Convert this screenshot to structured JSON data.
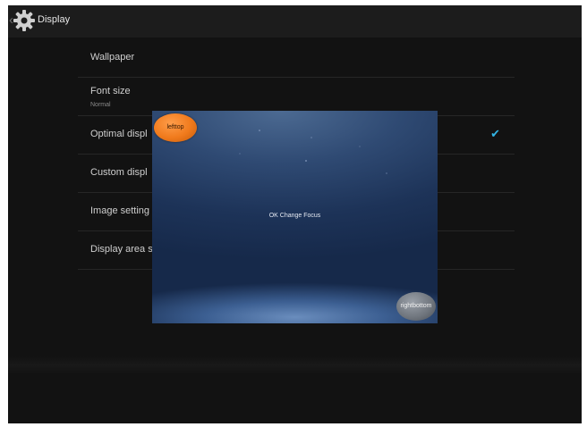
{
  "action_bar": {
    "title": "Display",
    "icon": "gear-icon"
  },
  "list": {
    "items": [
      {
        "label": "Wallpaper",
        "sub": ""
      },
      {
        "label": "Font size",
        "sub": "Normal"
      },
      {
        "label": "Optimal displ",
        "sub": "",
        "checked": true
      },
      {
        "label": "Custom displ",
        "sub": ""
      },
      {
        "label": "Image setting",
        "sub": ""
      },
      {
        "label": "Display area s",
        "sub": ""
      }
    ]
  },
  "dialog": {
    "message": "OK Change Focus",
    "left_top_button": "lefttop",
    "right_bottom_button": "rightbottom"
  },
  "colors": {
    "accent_check": "#33b5e5",
    "left_top_button": "#f07a1c",
    "right_bottom_button": "#6e747c"
  }
}
